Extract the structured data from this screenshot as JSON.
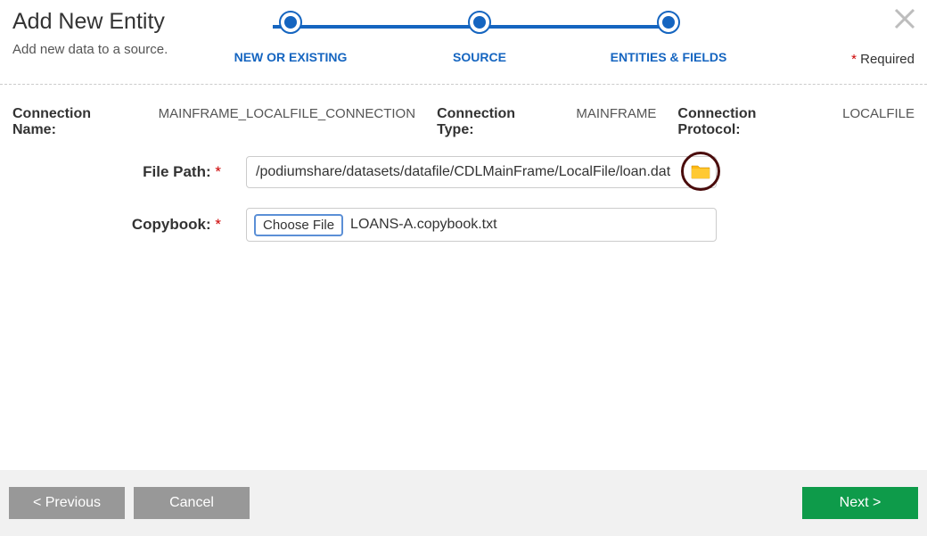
{
  "header": {
    "title": "Add New Entity",
    "subtitle": "Add new data to a source.",
    "required_label": "Required"
  },
  "stepper": {
    "steps": [
      {
        "label": "NEW OR EXISTING"
      },
      {
        "label": "SOURCE"
      },
      {
        "label": "ENTITIES & FIELDS"
      }
    ]
  },
  "connection": {
    "name_label": "Connection Name:",
    "name_value": "MAINFRAME_LOCALFILE_CONNECTION",
    "type_label": "Connection Type:",
    "type_value": "MAINFRAME",
    "protocol_label": "Connection Protocol:",
    "protocol_value": "LOCALFILE"
  },
  "form": {
    "filepath_label": "File Path:",
    "filepath_value": "/podiumshare/datasets/datafile/CDLMainFrame/LocalFile/loan.dat",
    "copybook_label": "Copybook:",
    "choose_file_label": "Choose File",
    "copybook_filename": "LOANS-A.copybook.txt"
  },
  "footer": {
    "previous": "< Previous",
    "cancel": "Cancel",
    "next": "Next >"
  }
}
